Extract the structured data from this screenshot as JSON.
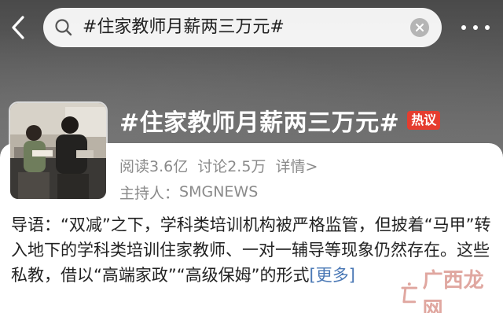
{
  "search": {
    "query": "#住家教师月薪两三万元#"
  },
  "topic": {
    "title": "#住家教师月薪两三万元#",
    "badge": "热议",
    "reads": "阅读3.6亿",
    "discussions": "讨论2.5万",
    "details": "详情>",
    "host_label": "主持人：",
    "host_name": "SMGNEWS",
    "intro": "导语：“双减”之下，学科类培训机构被严格监管，但披着“马甲”转入地下的学科类培训住家教师、一对一辅导等现象仍然存在。这些私教，借以“高端家政”“高级保姆”的形式",
    "more": "[更多]"
  },
  "watermark": {
    "text": "广西龙网"
  },
  "icons": {
    "back": "back-arrow-icon",
    "search": "search-icon",
    "clear": "clear-icon",
    "more": "more-dots-icon"
  },
  "colors": {
    "badge": "#e53d2f",
    "link": "#4a78b5",
    "muted": "#8a8a8a"
  }
}
